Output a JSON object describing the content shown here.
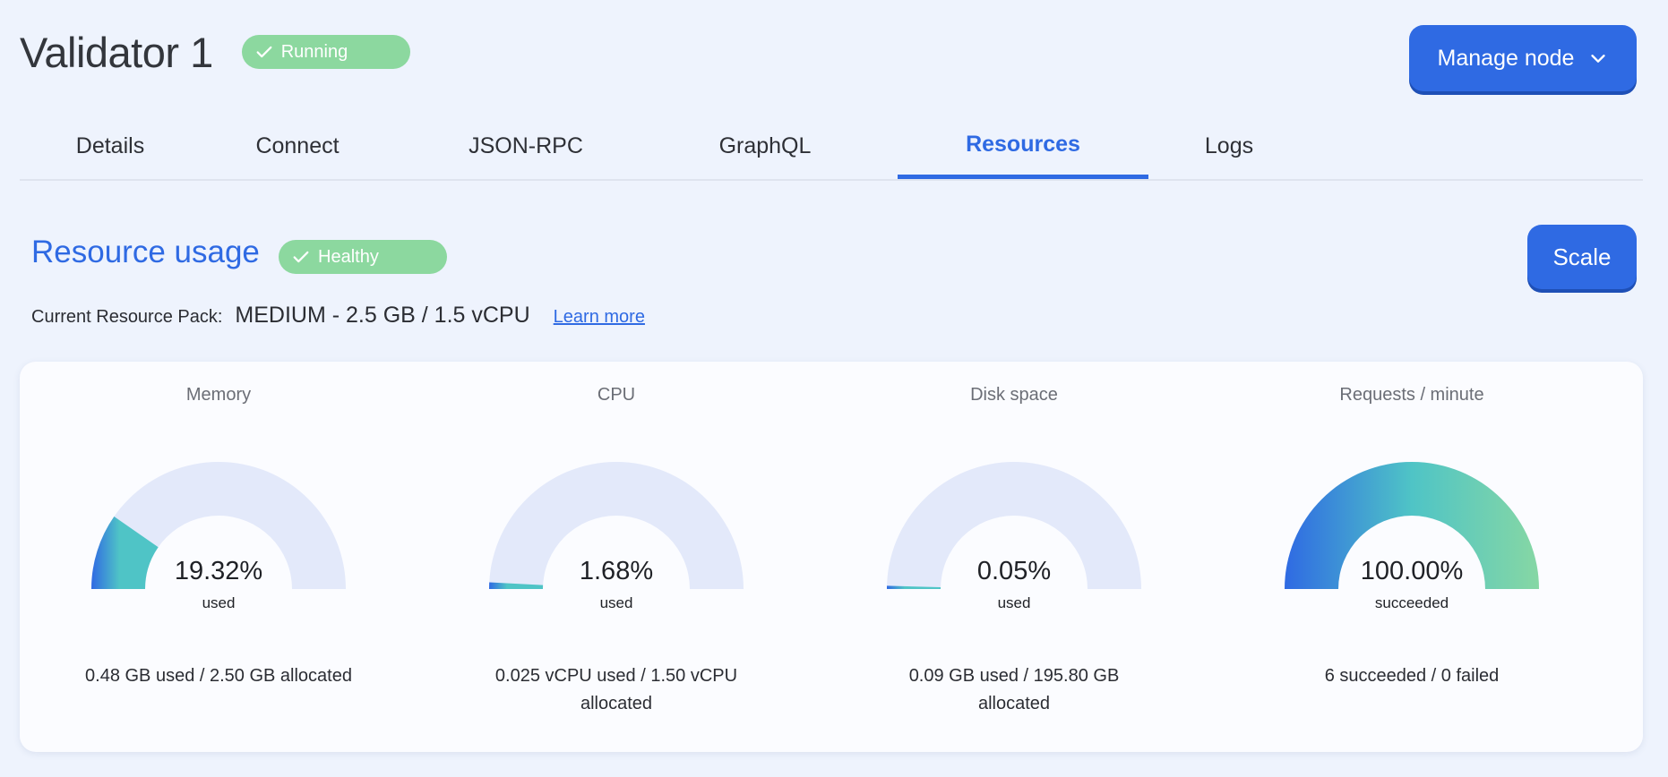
{
  "header": {
    "title": "Validator 1",
    "status": "Running",
    "manage_label": "Manage node"
  },
  "tabs": [
    {
      "label": "Details",
      "active": false
    },
    {
      "label": "Connect",
      "active": false
    },
    {
      "label": "JSON-RPC",
      "active": false
    },
    {
      "label": "GraphQL",
      "active": false
    },
    {
      "label": "Resources",
      "active": true
    },
    {
      "label": "Logs",
      "active": false
    }
  ],
  "resources": {
    "title": "Resource usage",
    "health": "Healthy",
    "scale_label": "Scale",
    "pack_label": "Current Resource Pack:",
    "pack_value": "MEDIUM -  2.5 GB / 1.5 vCPU",
    "learn_more": "Learn more"
  },
  "gauges": [
    {
      "title": "Memory",
      "percent": "19.32%",
      "fraction": 0.1932,
      "sub": "used",
      "detail": "0.48 GB used / 2.50 GB allocated"
    },
    {
      "title": "CPU",
      "percent": "1.68%",
      "fraction": 0.0168,
      "sub": "used",
      "detail": "0.025 vCPU used / 1.50 vCPU allocated"
    },
    {
      "title": "Disk space",
      "percent": "0.05%",
      "fraction": 0.0005,
      "sub": "used",
      "detail": "0.09 GB used / 195.80 GB allocated"
    },
    {
      "title": "Requests / minute",
      "percent": "100.00%",
      "fraction": 1.0,
      "sub": "succeeded",
      "detail": "6 succeeded / 0 failed"
    }
  ],
  "colors": {
    "accent": "#2f6ae3",
    "badge_green": "#8cd89f",
    "gauge_track": "#e3e9fa",
    "gauge_start": "#2f6ae3",
    "gauge_mid": "#4fc4c6",
    "gauge_end": "#86d7a4"
  },
  "icons": {
    "status_badge": "check-icon",
    "health_badge": "check-icon",
    "manage_button": "chevron-down-icon"
  }
}
